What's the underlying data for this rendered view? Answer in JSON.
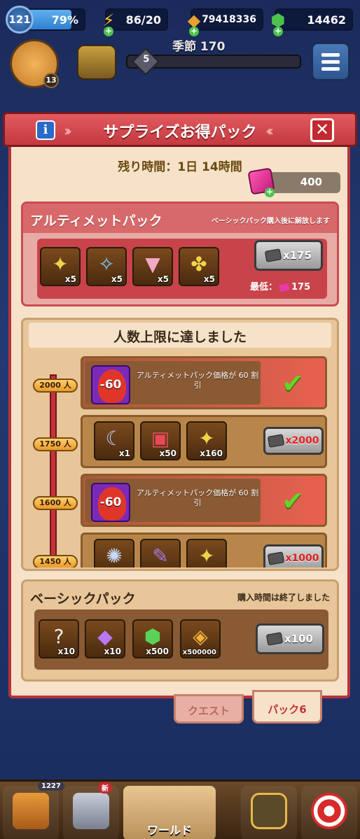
{
  "hud": {
    "level": "121",
    "xp_percent_label": "79%",
    "xp_fill": 0.79,
    "energy": "86/20",
    "gold": "79418336",
    "gems": "14462"
  },
  "season": {
    "label": "季節 170",
    "level": "5",
    "avatar_badge": "13"
  },
  "modal": {
    "title": "サプライズお得パック",
    "timer": "残り時間：1日 14時間",
    "ticket_balance": "400"
  },
  "ultimate": {
    "title": "アルティメットパック",
    "note": "ベーシックパック購入後に解放します",
    "items": [
      {
        "icon": "star-wand-icon",
        "qty": "x5"
      },
      {
        "icon": "gem-key-icon",
        "qty": "x5"
      },
      {
        "icon": "triangle-wand-icon",
        "qty": "x5"
      },
      {
        "icon": "ornate-key-icon",
        "qty": "x5"
      }
    ],
    "price": "x175",
    "min_label": "最低：",
    "min_price": "175"
  },
  "tiers": {
    "title": "人数上限に達しました",
    "rows": [
      {
        "milestone": "2000 人",
        "kind": "discount",
        "discount": "-60",
        "desc": "アルティメットパック価格が 60 割引",
        "status": "claimed"
      },
      {
        "milestone": "1750 人",
        "kind": "items",
        "items": [
          {
            "icon": "crescent-moon-icon",
            "qty": "x1"
          },
          {
            "icon": "red-chest-icon",
            "qty": "x50"
          },
          {
            "icon": "star-wand-icon",
            "qty": "x160"
          }
        ],
        "price": "x2000"
      },
      {
        "milestone": "1600 人",
        "kind": "discount",
        "discount": "-60",
        "desc": "アルティメットパック価格が 60 割引",
        "status": "claimed"
      },
      {
        "milestone": "1450 人",
        "kind": "items",
        "items": [
          {
            "icon": "crystal-badge-icon",
            "qty": ""
          },
          {
            "icon": "purple-scroll-icon",
            "qty": ""
          },
          {
            "icon": "star-wand-icon",
            "qty": ""
          }
        ],
        "price": "x1000"
      }
    ]
  },
  "basic": {
    "title": "ベーシックパック",
    "note": "購入時間は終了しました",
    "items": [
      {
        "icon": "mystery-piece-icon",
        "qty": "x10"
      },
      {
        "icon": "purple-crystal-icon",
        "qty": "x10"
      },
      {
        "icon": "green-gem-icon",
        "qty": "x500"
      },
      {
        "icon": "bow-card-icon",
        "qty": "x500000"
      }
    ],
    "price": "x100"
  },
  "tabs": {
    "quest": "クエスト",
    "pack": "パック6"
  },
  "nav": {
    "chest_badge": "1227",
    "armor_badge": "新",
    "world_label": "ワールド"
  },
  "colors": {
    "modal_red": "#c33a40",
    "panel_beige": "#f6e2c9",
    "check_green": "#6ad02a",
    "price_red": "#e02020"
  }
}
